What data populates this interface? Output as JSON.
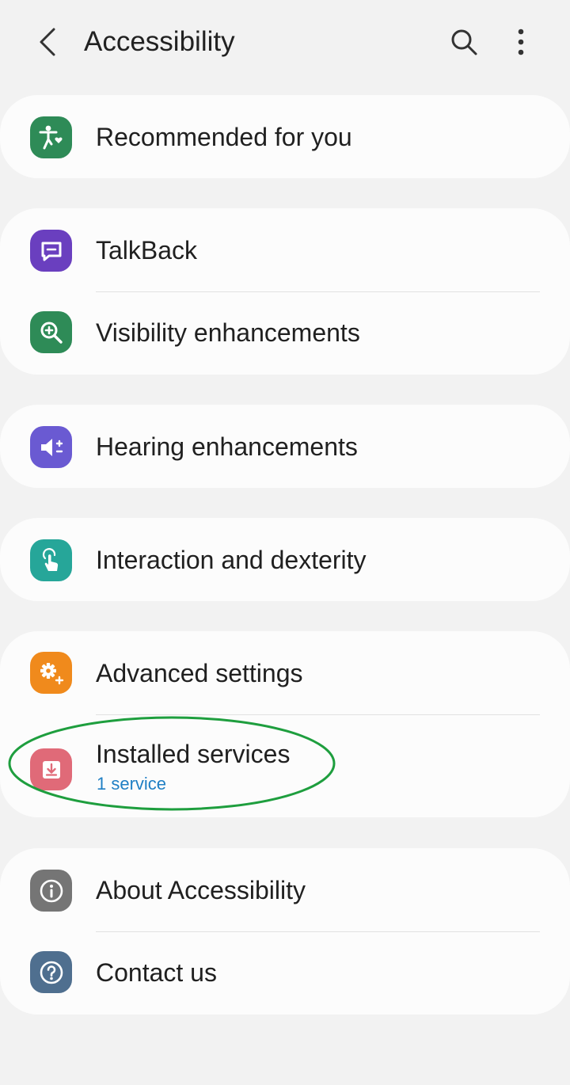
{
  "header": {
    "title": "Accessibility",
    "back_icon": "back-arrow-icon",
    "search_icon": "search-icon",
    "more_icon": "more-options-icon"
  },
  "groups": [
    {
      "items": [
        {
          "label": "Recommended for you",
          "icon": "accessibility-person-icon",
          "color": "#2e8b57"
        }
      ]
    },
    {
      "items": [
        {
          "label": "TalkBack",
          "icon": "speech-bubble-icon",
          "color": "#6a3fbf"
        },
        {
          "label": "Visibility enhancements",
          "icon": "zoom-in-icon",
          "color": "#2e8b57"
        }
      ]
    },
    {
      "items": [
        {
          "label": "Hearing enhancements",
          "icon": "volume-plus-minus-icon",
          "color": "#6a5ad2"
        }
      ]
    },
    {
      "items": [
        {
          "label": "Interaction and dexterity",
          "icon": "touch-hand-icon",
          "color": "#26a699"
        }
      ]
    },
    {
      "items": [
        {
          "label": "Advanced settings",
          "icon": "gear-plus-icon",
          "color": "#f08a1c"
        },
        {
          "label": "Installed services",
          "sublabel": "1 service",
          "icon": "download-icon",
          "color": "#e06a78"
        }
      ]
    },
    {
      "items": [
        {
          "label": "About Accessibility",
          "icon": "info-icon",
          "color": "#757575"
        },
        {
          "label": "Contact us",
          "icon": "question-icon",
          "color": "#4f6f8f"
        }
      ]
    }
  ],
  "annotation": {
    "shape": "ellipse",
    "color": "#1e9e3e",
    "target": "Installed services"
  }
}
